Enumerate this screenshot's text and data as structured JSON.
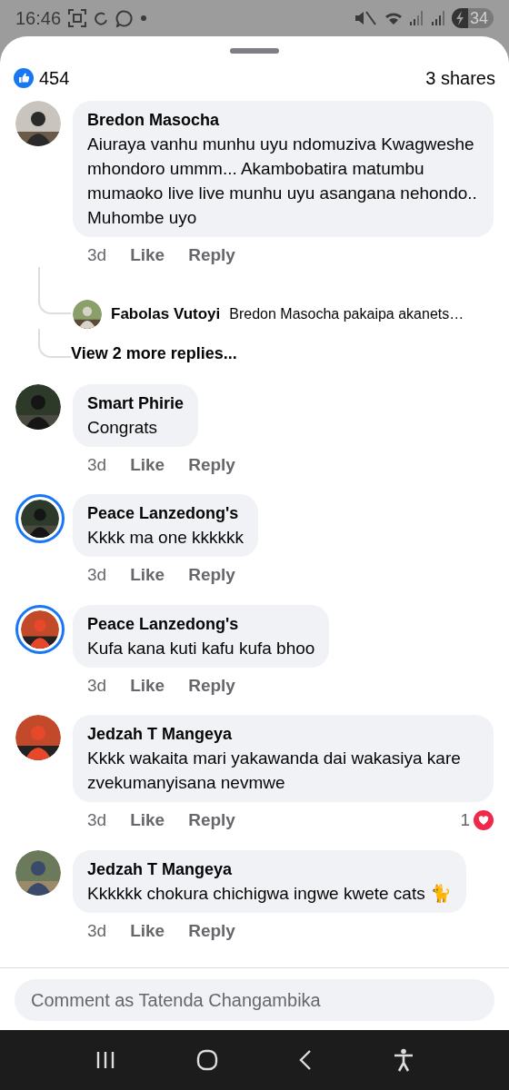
{
  "status_bar": {
    "time": "16:46",
    "battery": "34"
  },
  "reactions": {
    "count": "454",
    "shares": "3 shares"
  },
  "comments": [
    {
      "name": "Bredon Masocha",
      "text": "Aiuraya vanhu munhu uyu ndomuziva Kwagweshe mhondoro ummm... Akambobatira matumbu mumaoko live live munhu uyu asangana nehondo.. Muhombe uyo",
      "time": "3d",
      "like": "Like",
      "reply": "Reply",
      "story_ring": false,
      "replies": [
        {
          "name": "Fabolas Vutoyi",
          "text": "Bredon Masocha pakaipa akanets…"
        }
      ],
      "more_replies": "View 2 more replies..."
    },
    {
      "name": "Smart Phirie",
      "text": "Congrats",
      "time": "3d",
      "like": "Like",
      "reply": "Reply",
      "story_ring": false
    },
    {
      "name": "Peace Lanzedong's",
      "text": "Kkkk ma one kkkkkk",
      "time": "3d",
      "like": "Like",
      "reply": "Reply",
      "story_ring": true
    },
    {
      "name": "Peace Lanzedong's",
      "text": "Kufa kana kuti kafu kufa bhoo",
      "time": "3d",
      "like": "Like",
      "reply": "Reply",
      "story_ring": true
    },
    {
      "name": "Jedzah T Mangeya",
      "text": "Kkkk  wakaita mari yakawanda dai wakasiya kare zvekumanyisana nevmwe",
      "time": "3d",
      "like": "Like",
      "reply": "Reply",
      "story_ring": false,
      "reaction_count": "1"
    },
    {
      "name": "Jedzah T Mangeya",
      "text": "Kkkkkk  chokura chichigwa ingwe kwete cats 🐈",
      "time": "3d",
      "like": "Like",
      "reply": "Reply",
      "story_ring": false
    }
  ],
  "composer": {
    "placeholder": "Comment as Tatenda Changambika"
  }
}
